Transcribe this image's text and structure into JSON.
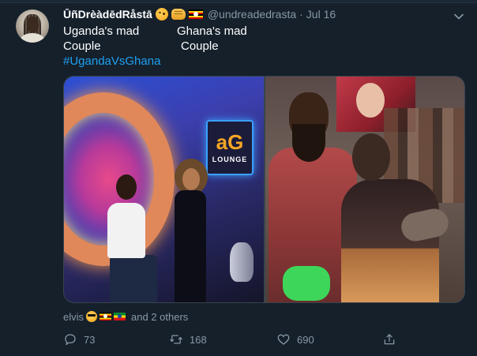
{
  "tweet": {
    "display_name": "ŪñDrèàdēdRåstā",
    "handle": "@undreadedrasta",
    "separator": "·",
    "date": "Jul 16",
    "text": {
      "col1_line1": "Uganda's mad",
      "col1_line2": "Couple",
      "col2_line1": "Ghana's mad",
      "col2_line2": "Couple",
      "hashtag": "#UgandaVsGhana"
    },
    "media": {
      "left_sign_logo": "aG",
      "left_sign_text": "LOUNGE"
    },
    "liked_by": {
      "name": "elvis",
      "suffix": "and 2 others"
    },
    "counts": {
      "replies": "73",
      "retweets": "168",
      "likes": "690"
    }
  },
  "icons": {
    "name_badges": [
      "wink-face-icon",
      "fist-bump-icon",
      "uganda-flag-icon"
    ],
    "liker_badges": [
      "cool-face-icon",
      "uganda-flag-icon",
      "ethiopia-flag-icon"
    ],
    "actions": [
      "reply-icon",
      "retweet-icon",
      "like-icon",
      "share-icon"
    ],
    "menu": "chevron-down-icon"
  },
  "colors": {
    "background": "#15202b",
    "text_primary": "#ffffff",
    "text_secondary": "#8899a6",
    "link": "#1da1f2",
    "border": "#38444d"
  }
}
